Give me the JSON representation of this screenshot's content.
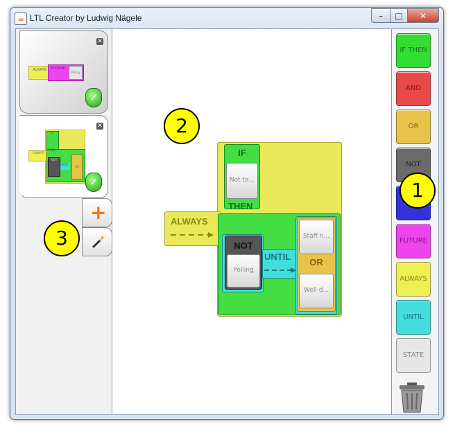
{
  "window": {
    "title": "LTL Creator by Ludwig Nägele",
    "min_label": "–",
    "max_label": "□",
    "close_label": "✕"
  },
  "tabs": [
    {
      "close_label": "✕",
      "status_icon": "check-shield-icon",
      "thumb": {
        "always": "ALWAYS",
        "future": "FUTURE",
        "state": "Polling"
      }
    },
    {
      "close_label": "✕",
      "status_icon": "check-shield-icon",
      "thumb": {
        "always": "ALWAYS",
        "if": "IF",
        "then": "THEN",
        "not": "NOT",
        "until": "UNTIL",
        "or": "OR"
      }
    }
  ],
  "tab_actions": {
    "add": "plus-icon",
    "wand": "magic-wand-icon"
  },
  "palette": {
    "items": [
      {
        "label": "IF THEN",
        "bg": "#33dd33",
        "fg": "#1d7a1d"
      },
      {
        "label": "AND",
        "bg": "#e84a4a",
        "fg": "#8a1313"
      },
      {
        "label": "OR",
        "bg": "#e8c34a",
        "fg": "#806410"
      },
      {
        "label": "NOT",
        "bg": "#6b6b6b",
        "fg": "#222222"
      },
      {
        "label": "NEXT",
        "bg": "#3333dd",
        "fg": "#aab4ff"
      },
      {
        "label": "FUTURE",
        "bg": "#ee44ee",
        "fg": "#7d157d"
      },
      {
        "label": "ALWAYS",
        "bg": "#eeee55",
        "fg": "#8a8a10"
      },
      {
        "label": "UNTIL",
        "bg": "#44dddd",
        "fg": "#147a7a"
      },
      {
        "label": "STATE",
        "bg": "#e6e6e6",
        "fg": "#8a8a8a"
      }
    ],
    "trash_icon": "trash-can-icon"
  },
  "callouts": {
    "one": "1",
    "two": "2",
    "three": "3"
  },
  "diagram": {
    "always_label": "ALWAYS",
    "if_label": "IF",
    "if_state": "Not ta...",
    "then_label": "THEN",
    "not_label": "NOT",
    "not_state": "Polling",
    "until_label": "UNTIL",
    "or_label": "OR",
    "or_state_1": "Staff n...",
    "or_state_2": "Well d..."
  }
}
